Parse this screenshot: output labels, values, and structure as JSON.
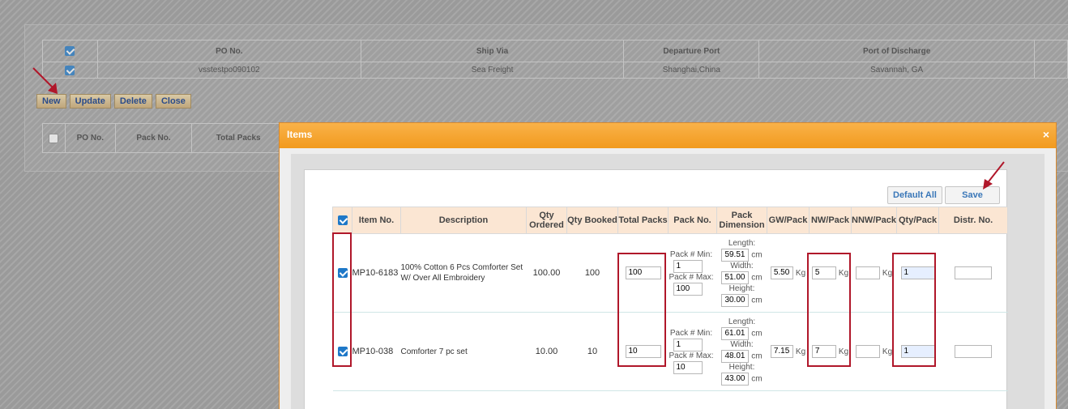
{
  "background": {
    "header": {
      "po_no": "PO No.",
      "ship_via": "Ship Via",
      "departure_port": "Departure Port",
      "port_of_discharge": "Port of Discharge"
    },
    "row": {
      "po_no": "vsstestpo090102",
      "ship_via": "Sea Freight",
      "departure_port": "Shanghai,China",
      "port_of_discharge": "Savannah, GA"
    },
    "buttons": {
      "new": "New",
      "update": "Update",
      "delete": "Delete",
      "close": "Close"
    },
    "table2": {
      "po_no": "PO No.",
      "pack_no": "Pack No.",
      "total_packs": "Total Packs"
    }
  },
  "modal": {
    "title": "Items",
    "close_icon": "×",
    "default_all_label": "Default All",
    "save_label": "Save",
    "columns": {
      "item_no": "Item No.",
      "description": "Description",
      "qty_ordered": "Qty Ordered",
      "qty_booked": "Qty Booked",
      "total_packs": "Total Packs",
      "pack_no": "Pack No.",
      "pack_dimension": "Pack Dimension",
      "gw_pack": "GW/Pack",
      "nw_pack": "NW/Pack",
      "nnw_pack": "NNW/Pack",
      "qty_pack": "Qty/Pack",
      "distr_no": "Distr. No."
    },
    "labels": {
      "pack_min": "Pack # Min:",
      "pack_max": "Pack # Max:",
      "length": "Length:",
      "width": "Width:",
      "height": "Height:",
      "cm": "cm",
      "kg": "Kg"
    },
    "rows": [
      {
        "item_no": "MP10-6183",
        "description": "100% Cotton 6 Pcs Comforter Set W/ Over All Embroidery",
        "qty_ordered": "100.00",
        "qty_booked": "100",
        "total_packs": "100",
        "pack_min": "1",
        "pack_max": "100",
        "length": "59.51",
        "width": "51.00",
        "height": "30.00",
        "gw": "5.50",
        "nw": "5",
        "nnw": "",
        "qty_pack": "1",
        "distr_no": ""
      },
      {
        "item_no": "MP10-038",
        "description": "Comforter 7 pc set",
        "qty_ordered": "10.00",
        "qty_booked": "10",
        "total_packs": "10",
        "pack_min": "1",
        "pack_max": "10",
        "length": "61.01",
        "width": "48.01",
        "height": "43.00",
        "gw": "7.15",
        "nw": "7",
        "nnw": "",
        "qty_pack": "1",
        "distr_no": ""
      }
    ]
  },
  "colors": {
    "annotation_red": "#b0172a",
    "modal_header": "#f5a12e",
    "header_row": "#fbe6d3"
  }
}
